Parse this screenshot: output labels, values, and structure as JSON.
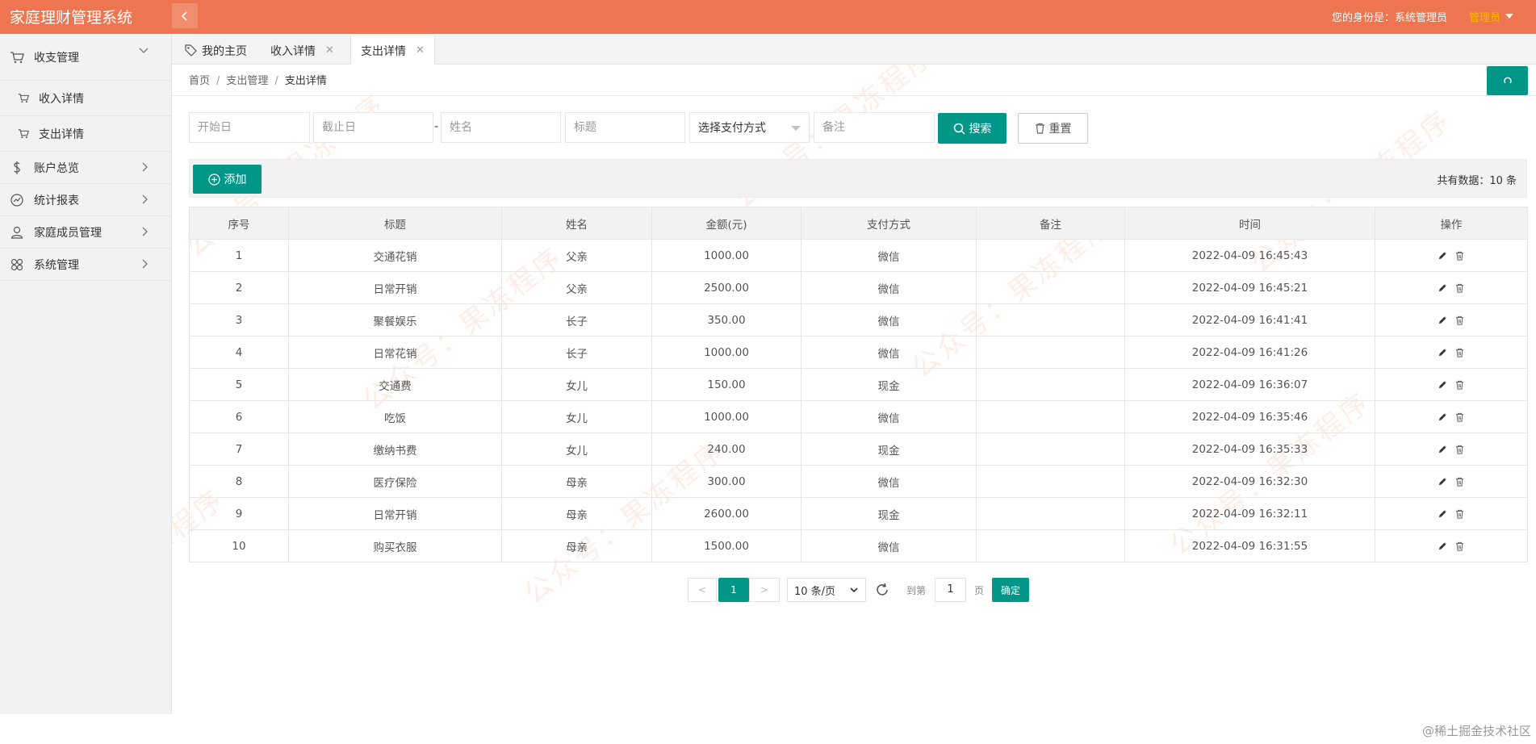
{
  "header": {
    "title": "家庭理财管理系统",
    "identity_label": "您的身份是：系统管理员",
    "role": "管理员"
  },
  "sidebar": {
    "items": [
      {
        "label": "收支管理",
        "icon": "cart-icon"
      },
      {
        "label": "收入详情",
        "icon": "cart-icon"
      },
      {
        "label": "支出详情",
        "icon": "cart-icon"
      },
      {
        "label": "账户总览",
        "icon": "dollar-icon"
      },
      {
        "label": "统计报表",
        "icon": "chart-icon"
      },
      {
        "label": "家庭成员管理",
        "icon": "user-icon"
      },
      {
        "label": "系统管理",
        "icon": "grid-icon"
      }
    ]
  },
  "tabs": [
    {
      "label": "我的主页"
    },
    {
      "label": "收入详情"
    },
    {
      "label": "支出详情"
    }
  ],
  "breadcrumb": [
    "首页",
    "支出管理",
    "支出详情"
  ],
  "search": {
    "start_placeholder": "开始日",
    "end_placeholder": "截止日",
    "separator": "-",
    "name_placeholder": "姓名",
    "title_placeholder": "标题",
    "payment_select": "选择支付方式",
    "note_placeholder": "备注",
    "search_label": "搜索",
    "reset_label": "重置"
  },
  "toolbar": {
    "add_label": "添加",
    "total_text": "共有数据：10 条"
  },
  "table": {
    "columns": [
      "序号",
      "标题",
      "姓名",
      "金额(元)",
      "支付方式",
      "备注",
      "时间",
      "操作"
    ],
    "rows": [
      [
        "1",
        "交通花销",
        "父亲",
        "1000.00",
        "微信",
        "",
        "2022-04-09 16:45:43"
      ],
      [
        "2",
        "日常开销",
        "父亲",
        "2500.00",
        "微信",
        "",
        "2022-04-09 16:45:21"
      ],
      [
        "3",
        "聚餐娱乐",
        "长子",
        "350.00",
        "微信",
        "",
        "2022-04-09 16:41:41"
      ],
      [
        "4",
        "日常花销",
        "长子",
        "1000.00",
        "微信",
        "",
        "2022-04-09 16:41:26"
      ],
      [
        "5",
        "交通费",
        "女儿",
        "150.00",
        "现金",
        "",
        "2022-04-09 16:36:07"
      ],
      [
        "6",
        "吃饭",
        "女儿",
        "1000.00",
        "微信",
        "",
        "2022-04-09 16:35:46"
      ],
      [
        "7",
        "缴纳书费",
        "女儿",
        "240.00",
        "现金",
        "",
        "2022-04-09 16:35:33"
      ],
      [
        "8",
        "医疗保险",
        "母亲",
        "300.00",
        "微信",
        "",
        "2022-04-09 16:32:30"
      ],
      [
        "9",
        "日常开销",
        "母亲",
        "2600.00",
        "现金",
        "",
        "2022-04-09 16:32:11"
      ],
      [
        "10",
        "购买衣服",
        "母亲",
        "1500.00",
        "微信",
        "",
        "2022-04-09 16:31:55"
      ]
    ]
  },
  "pager": {
    "prev": "<",
    "current": "1",
    "next": ">",
    "page_size": "10 条/页",
    "goto_label": "到第",
    "goto_value": "1",
    "page_unit": "页",
    "confirm_label": "确定"
  },
  "watermark": "公众号：果冻程序",
  "footer_mark": "@稀土掘金技术社区",
  "colors": {
    "header": "#ED7550",
    "primary": "#009688",
    "role": "#FFB800"
  }
}
